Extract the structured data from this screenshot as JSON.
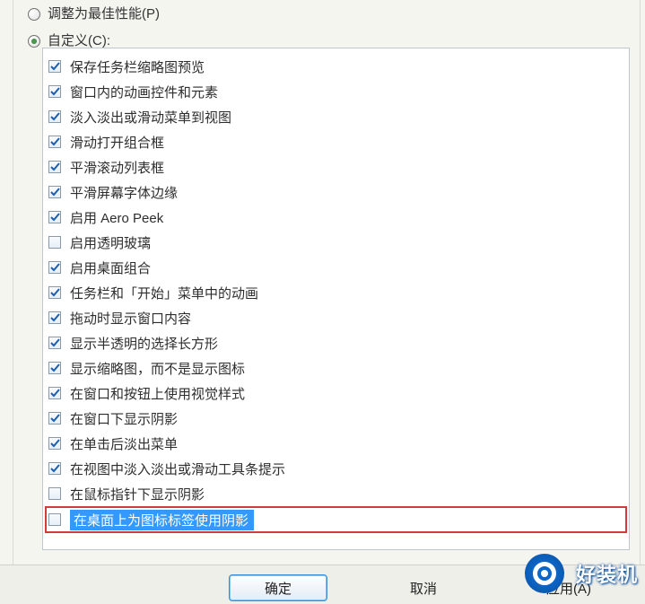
{
  "radios": {
    "best_performance": {
      "label": "调整为最佳性能(P)",
      "selected": false
    },
    "custom": {
      "label": "自定义(C):",
      "selected": true
    }
  },
  "options": [
    {
      "label": "保存任务栏缩略图预览",
      "checked": true
    },
    {
      "label": "窗口内的动画控件和元素",
      "checked": true
    },
    {
      "label": "淡入淡出或滑动菜单到视图",
      "checked": true
    },
    {
      "label": "滑动打开组合框",
      "checked": true
    },
    {
      "label": "平滑滚动列表框",
      "checked": true
    },
    {
      "label": "平滑屏幕字体边缘",
      "checked": true
    },
    {
      "label": "启用 Aero Peek",
      "checked": true
    },
    {
      "label": "启用透明玻璃",
      "checked": false
    },
    {
      "label": "启用桌面组合",
      "checked": true
    },
    {
      "label": "任务栏和「开始」菜单中的动画",
      "checked": true
    },
    {
      "label": "拖动时显示窗口内容",
      "checked": true
    },
    {
      "label": "显示半透明的选择长方形",
      "checked": true
    },
    {
      "label": "显示缩略图，而不是显示图标",
      "checked": true
    },
    {
      "label": "在窗口和按钮上使用视觉样式",
      "checked": true
    },
    {
      "label": "在窗口下显示阴影",
      "checked": true
    },
    {
      "label": "在单击后淡出菜单",
      "checked": true
    },
    {
      "label": "在视图中淡入淡出或滑动工具条提示",
      "checked": true
    },
    {
      "label": "在鼠标指针下显示阴影",
      "checked": false
    }
  ],
  "highlighted": {
    "label": "在桌面上为图标标签使用阴影",
    "checked": false
  },
  "buttons": {
    "ok": "确定",
    "cancel": "取消",
    "apply": "应用(A)"
  },
  "watermark": "好装机"
}
